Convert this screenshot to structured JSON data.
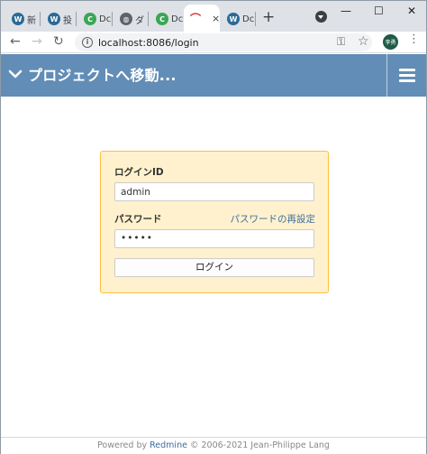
{
  "browser": {
    "tabs": [
      {
        "favicon": "wordpress-icon",
        "label": "新"
      },
      {
        "favicon": "wordpress-icon",
        "label": "投"
      },
      {
        "favicon": "dc-icon",
        "label": "Dc"
      },
      {
        "favicon": "globe-icon",
        "label": "ダ"
      },
      {
        "favicon": "dc-icon",
        "label": "Dc"
      },
      {
        "favicon": "redmine-icon",
        "label": "",
        "active": true
      },
      {
        "favicon": "wordpress-icon",
        "label": "Dc"
      }
    ],
    "close_glyph": "×",
    "new_tab_glyph": "+",
    "url": "localhost:8086/login",
    "avatar_text": "李勇",
    "window_controls": {
      "minimize": "—",
      "maximize": "☐",
      "close": "✕"
    }
  },
  "header": {
    "project_jump_label": "プロジェクトへ移動..."
  },
  "login": {
    "username_label": "ログインID",
    "username_value": "admin",
    "password_label": "パスワード",
    "lost_password_link": "パスワードの再設定",
    "password_value": "•••••",
    "submit_label": "ログイン"
  },
  "footer": {
    "powered_by": "Powered by ",
    "app_name": "Redmine",
    "copyright": " © 2006-2021 Jean-Philippe Lang"
  },
  "colors": {
    "header_bg": "#628db6",
    "login_box_bg": "#fff1cd",
    "login_box_border": "#fdbf3b",
    "link": "#3e6d9c"
  }
}
